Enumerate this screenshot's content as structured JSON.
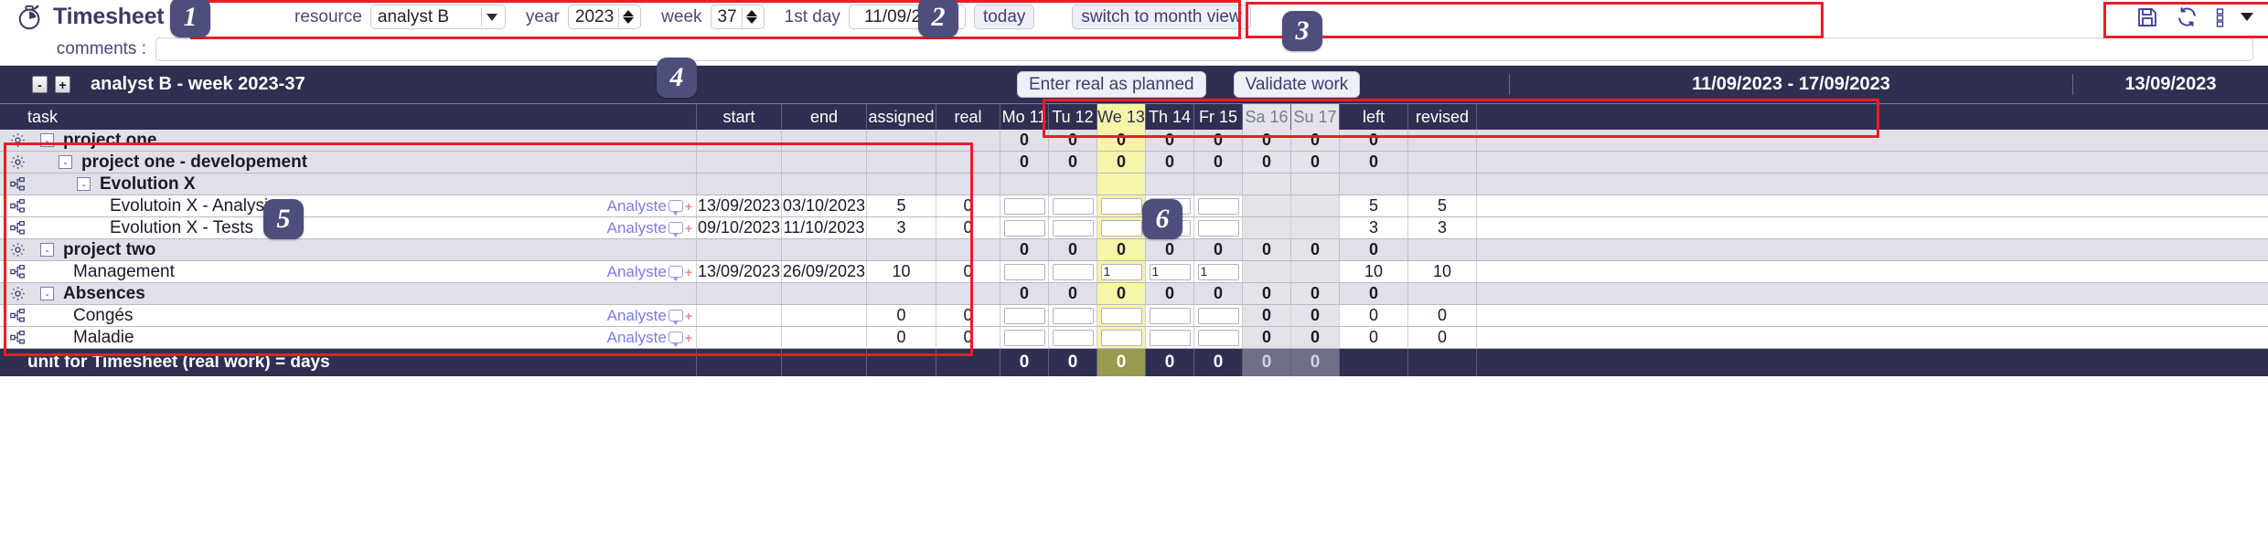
{
  "app": {
    "title": "Timesheet",
    "logo_icon": "stopwatch-icon"
  },
  "toolbar": {
    "resource_label": "resource",
    "resource_value": "analyst B",
    "year_label": "year",
    "year_value": "2023",
    "week_label": "week",
    "week_value": "37",
    "first_day_label": "1st day",
    "first_day_value": "11/09/2023",
    "today_button": "today",
    "switch_view_button": "switch to month view",
    "save_icon": "save-icon",
    "refresh_icon": "refresh-icon",
    "menu_icon": "more-options-icon",
    "caret_icon": "chevron-down-icon"
  },
  "comments": {
    "label": "comments :",
    "value": "",
    "placeholder": ""
  },
  "band": {
    "collapse_all": "-",
    "expand_all": "+",
    "title": "analyst B - week 2023-37",
    "enter_real_as_planned_button": "Enter real as planned",
    "validate_work_button": "Validate work",
    "date_range": "11/09/2023 - 17/09/2023",
    "today_date": "13/09/2023"
  },
  "columns": {
    "task": "task",
    "start": "start",
    "end": "end",
    "assigned": "assigned",
    "real": "real",
    "days": [
      {
        "label": "Mo 11",
        "type": "weekday"
      },
      {
        "label": "Tu 12",
        "type": "weekday"
      },
      {
        "label": "We 13",
        "type": "today"
      },
      {
        "label": "Th 14",
        "type": "weekday"
      },
      {
        "label": "Fr 15",
        "type": "weekday"
      },
      {
        "label": "Sa 16",
        "type": "weekend"
      },
      {
        "label": "Su 17",
        "type": "weekend"
      }
    ],
    "left": "left",
    "revised": "revised"
  },
  "rows": [
    {
      "kind": "group",
      "indent": 0,
      "icon": "gear-icon",
      "toggle": "-",
      "name": "project one",
      "bold": true,
      "start": "",
      "end": "",
      "assigned": "",
      "real": "",
      "assignee": "",
      "inputs": false,
      "days": [
        "0",
        "0",
        "0",
        "0",
        "0",
        "0",
        "0"
      ],
      "left": "0",
      "revised": ""
    },
    {
      "kind": "group",
      "indent": 1,
      "icon": "gear-icon",
      "toggle": "-",
      "name": "project one - developement",
      "bold": true,
      "start": "",
      "end": "",
      "assigned": "",
      "real": "",
      "assignee": "",
      "inputs": false,
      "days": [
        "0",
        "0",
        "0",
        "0",
        "0",
        "0",
        "0"
      ],
      "left": "0",
      "revised": ""
    },
    {
      "kind": "group",
      "indent": 2,
      "icon": "task-icon",
      "toggle": "-",
      "name": "Evolution X",
      "bold": true,
      "start": "",
      "end": "",
      "assigned": "",
      "real": "",
      "assignee": "",
      "inputs": false,
      "days": [
        "",
        "",
        "",
        "",
        "",
        "",
        ""
      ],
      "left": "",
      "revised": ""
    },
    {
      "kind": "leaf",
      "indent": 3,
      "icon": "task-icon",
      "toggle": "",
      "name": "Evolutoin X - Analysis",
      "bold": false,
      "start": "13/09/2023",
      "end": "03/10/2023",
      "assigned": "5",
      "real": "0",
      "assignee": "Analyste",
      "inputs": true,
      "days": [
        "",
        "",
        "",
        "",
        "",
        "",
        ""
      ],
      "left": "5",
      "revised": "5"
    },
    {
      "kind": "leaf",
      "indent": 3,
      "icon": "task-icon",
      "toggle": "",
      "name": "Evolution X - Tests",
      "bold": false,
      "start": "09/10/2023",
      "end": "11/10/2023",
      "assigned": "3",
      "real": "0",
      "assignee": "Analyste",
      "inputs": true,
      "days": [
        "",
        "",
        "",
        "",
        "",
        "",
        ""
      ],
      "left": "3",
      "revised": "3"
    },
    {
      "kind": "group",
      "indent": 0,
      "icon": "gear-icon",
      "toggle": "-",
      "name": "project two",
      "bold": true,
      "start": "",
      "end": "",
      "assigned": "",
      "real": "",
      "assignee": "",
      "inputs": false,
      "days": [
        "0",
        "0",
        "0",
        "0",
        "0",
        "0",
        "0"
      ],
      "left": "0",
      "revised": ""
    },
    {
      "kind": "leaf",
      "indent": 1,
      "icon": "task-icon",
      "toggle": "",
      "name": "Management",
      "bold": false,
      "start": "13/09/2023",
      "end": "26/09/2023",
      "assigned": "10",
      "real": "0",
      "assignee": "Analyste",
      "inputs": true,
      "days": [
        "",
        "",
        "1",
        "1",
        "1",
        "",
        ""
      ],
      "left": "10",
      "revised": "10"
    },
    {
      "kind": "group",
      "indent": 0,
      "icon": "gear-icon",
      "toggle": "-",
      "name": "Absences",
      "bold": true,
      "start": "",
      "end": "",
      "assigned": "",
      "real": "",
      "assignee": "",
      "inputs": false,
      "days": [
        "0",
        "0",
        "0",
        "0",
        "0",
        "0",
        "0"
      ],
      "left": "0",
      "revised": ""
    },
    {
      "kind": "leaf",
      "indent": 1,
      "icon": "task-icon",
      "toggle": "",
      "name": "Congés",
      "bold": false,
      "start": "",
      "end": "",
      "assigned": "0",
      "real": "0",
      "assignee": "Analyste",
      "inputs": true,
      "days": [
        "",
        "",
        "",
        "",
        "",
        "0",
        "0"
      ],
      "left": "0",
      "revised": "0"
    },
    {
      "kind": "leaf",
      "indent": 1,
      "icon": "task-icon",
      "toggle": "",
      "name": "Maladie",
      "bold": false,
      "start": "",
      "end": "",
      "assigned": "0",
      "real": "0",
      "assignee": "Analyste",
      "inputs": true,
      "days": [
        "",
        "",
        "",
        "",
        "",
        "0",
        "0"
      ],
      "left": "0",
      "revised": "0"
    }
  ],
  "footer": {
    "label": "unit for Timesheet (real work) = days",
    "days": [
      "0",
      "0",
      "0",
      "0",
      "0",
      "0",
      "0"
    ],
    "left": "",
    "revised": ""
  },
  "annotations": [
    {
      "number": "1"
    },
    {
      "number": "2"
    },
    {
      "number": "3"
    },
    {
      "number": "4"
    },
    {
      "number": "5"
    },
    {
      "number": "6"
    }
  ],
  "colors": {
    "header_bg": "#2f2f52",
    "accent": "#4e4e7d",
    "today_highlight": "#f7f5a8",
    "weekend": "#e3e3ea",
    "annotation_red": "#ee1c25"
  }
}
